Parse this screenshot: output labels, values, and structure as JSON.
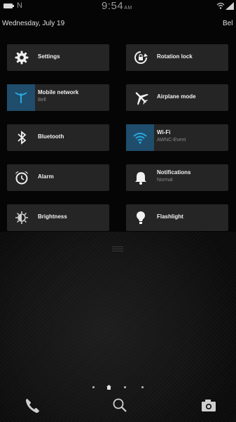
{
  "status_bar": {
    "time": "9:54",
    "ampm": "AM",
    "notification_icon": "N",
    "battery_icon": "battery-icon",
    "wifi_icon": "wifi-icon",
    "signal_icon": "signal-icon"
  },
  "header": {
    "date": "Wednesday, July 19",
    "carrier_short": "Bel"
  },
  "tiles": {
    "settings": {
      "label": "Settings",
      "icon": "gear-icon"
    },
    "rotation_lock": {
      "label": "Rotation lock",
      "icon": "rotation-lock-icon"
    },
    "mobile_network": {
      "label": "Mobile network",
      "status": "Bell",
      "icon": "antenna-icon",
      "active": true
    },
    "airplane_mode": {
      "label": "Airplane mode",
      "icon": "airplane-icon"
    },
    "bluetooth": {
      "label": "Bluetooth",
      "icon": "bluetooth-icon"
    },
    "wifi": {
      "label": "Wi-Fi",
      "status": "AWNC-Event",
      "icon": "wifi-icon",
      "active": true
    },
    "alarm": {
      "label": "Alarm",
      "icon": "alarm-clock-icon"
    },
    "notifications": {
      "label": "Notifications",
      "status": "Normal",
      "icon": "bell-icon"
    },
    "brightness": {
      "label": "Brightness",
      "icon": "brightness-icon"
    },
    "flashlight": {
      "label": "Flashlight",
      "icon": "lightbulb-icon"
    }
  },
  "dock": {
    "phone_icon": "phone-icon",
    "search_icon": "search-icon",
    "camera_icon": "camera-icon"
  },
  "colors": {
    "tile_bg": "#252525",
    "active_accent": "#1f4d6b",
    "icon_blue": "#29a8e0",
    "shade_bg": "#050505"
  }
}
